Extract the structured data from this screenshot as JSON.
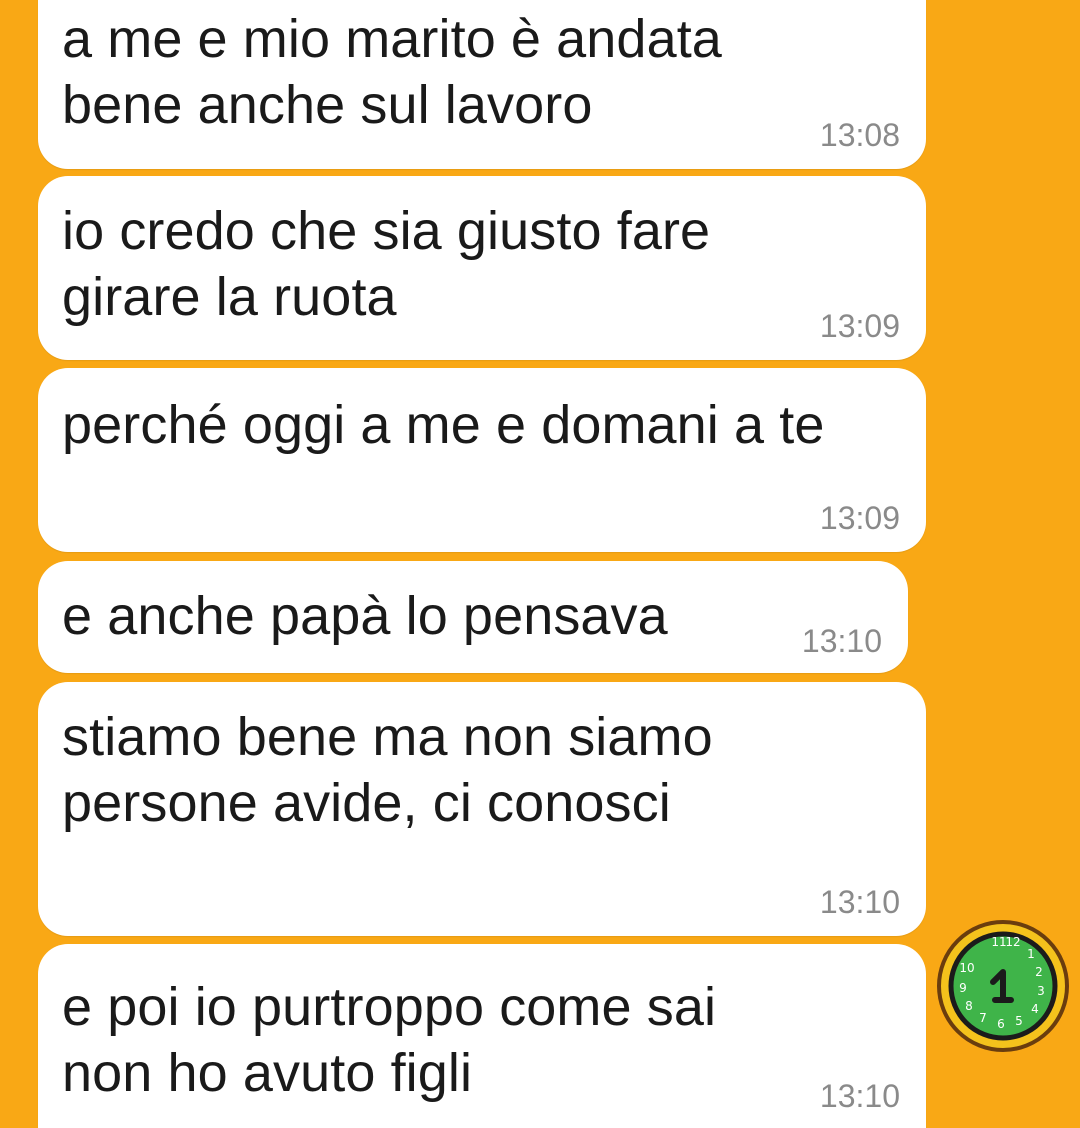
{
  "theme": {
    "background": "#f9a815",
    "bubble": "#ffffff",
    "text": "#1a1a1a",
    "timestamp": "#8a8a8a",
    "clock_face": "#3fb449"
  },
  "messages": [
    {
      "text": "a me e mio marito è andata\nbene anche sul lavoro",
      "time": "13:08"
    },
    {
      "text": "io credo che sia giusto fare\ngirare la ruota",
      "time": "13:09"
    },
    {
      "text": "perché oggi a me e domani a te",
      "time": "13:09"
    },
    {
      "text": "e anche papà lo pensava",
      "time": "13:10"
    },
    {
      "text": "stiamo bene  ma non siamo\npersone avide, ci conosci",
      "time": "13:10"
    },
    {
      "text": "e poi io purtroppo come sai\nnon ho avuto figli",
      "time": "13:10"
    }
  ],
  "sticker": {
    "icon": "clock-icon"
  }
}
